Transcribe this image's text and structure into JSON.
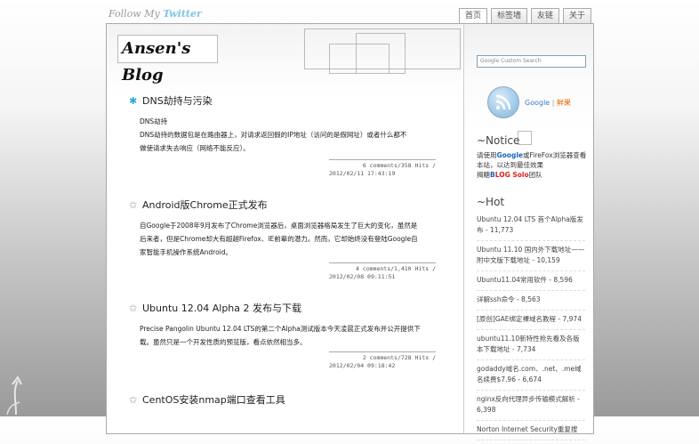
{
  "follow": {
    "prefix": "Follow My ",
    "twitter": "Twitter"
  },
  "tabs": [
    "首页",
    "标签墙",
    "友链",
    "关于"
  ],
  "logo": "Ansen's Blog",
  "search": {
    "placeholder": "Google Custom Search"
  },
  "rss": {
    "google": "Google",
    "sep": " | ",
    "xianguo": "鲜果"
  },
  "notice": {
    "title": "~Notice",
    "line1": "请使用",
    "google_word": "Google",
    "line1b": "或FireFox浏览器查看本站，以达到最佳效果",
    "line2_prefix": "揭糖",
    "solo1": "B",
    "solo2": "LOG Solo",
    "line2_suffix": "团队"
  },
  "hot": {
    "title": "~Hot",
    "items": [
      "Ubuntu 12.04 LTS 首个Alpha版发布 - 11,773",
      "Ubuntu 11.10 国内外下载地址——附中文版下载地址 - 10,159",
      "Ubuntu11.04常用软件 - 8,596",
      "详解ssh命令 - 8,563",
      "[原创]GAE绑定裸域名教程 - 7,974",
      "ubuntu11.10新特性抢先看及各版本下载地址 - 7,734",
      "godaddy域名.com、.net、.me域名续费$7.96 - 6,674",
      "nginx反向代理异步传输模式解析 - 6,398",
      "Norton Internet Security重复搜"
    ]
  },
  "posts": [
    {
      "title": "DNS劫持与污染",
      "body_lines": [
        "DNS劫持",
        "DNS劫持的数据包是在路由器上，对请求返回假的IP地址（访问的是假网址）或者什么都不",
        "做使请求失去响应（网络不能反应）。"
      ],
      "meta1": "6 comments/358 Hits /",
      "meta2": "2012/02/11 17:43:19"
    },
    {
      "title": "Android版Chrome正式发布",
      "body_lines": [
        "自Google于2008年9月发布了Chrome浏览器后，桌面浏览器格局发生了巨大的变化，虽然是",
        "后来者，但是Chrome却大有超越Firefox、IE前辈的潜力。然而，它却始终没有登陆Google自",
        "家智能手机操作系统Android。"
      ],
      "meta1": "4 comments/1,410 Hits /",
      "meta2": "2012/02/08 09:11:51"
    },
    {
      "title": "Ubuntu 12.04 Alpha 2 发布与下载",
      "body_lines": [
        "Precise Pangolin Ubuntu 12.04 LTS的第二个Alpha测试版本今天凌晨正式发布并公开提供下",
        "载。虽然只是一个开发性质的预览版，看点依然相当多。"
      ],
      "meta1": "2 comments/728 Hits /",
      "meta2": "2012/02/04 09:18:42"
    },
    {
      "title": "CentOS安装nmap端口查看工具",
      "body_lines": [],
      "meta1": "",
      "meta2": ""
    }
  ]
}
